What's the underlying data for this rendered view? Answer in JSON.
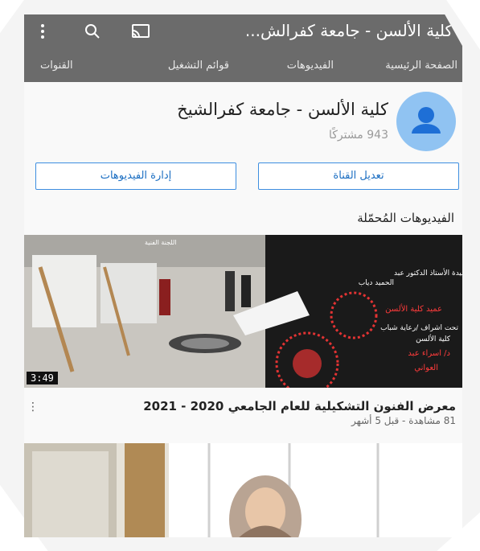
{
  "topbar": {
    "title": "كلية الألسن - جامعة كفرالش...",
    "icons": [
      "more-vert-icon",
      "search-icon",
      "cast-icon"
    ]
  },
  "tabs": [
    {
      "label": "الصفحة الرئيسية"
    },
    {
      "label": "الفيديوهات"
    },
    {
      "label": "قوائم التشغيل"
    },
    {
      "label": "القنوات"
    }
  ],
  "channel": {
    "name": "كلية الألسن - جامعة كفرالشيخ",
    "subscribers": "943 مشتركًا",
    "edit_button": "تعديل القناة",
    "manage_button": "إدارة الفيديوهات"
  },
  "section": {
    "title": "الفيديوهات المُحمّلة"
  },
  "video": {
    "title": "معرض الفنون التشكيلية للعام الجامعي 2020 - 2021",
    "meta": "81 مشاهدة - قبل 5 أشهر",
    "duration": "3:49",
    "thumbnail_text": [
      "اللجنة الفنية",
      "عميدة الأستاذ الدكتور عبد",
      "الحميد دياب",
      "عميد كلية الألسن",
      "تحت اشراف /رعاية شباب",
      "كلية الألسن",
      "د/ اسراء عبد",
      "العواني"
    ]
  },
  "colors": {
    "topbar": "#6b6b6b",
    "accent": "#3d8ee0",
    "avatar": "#90c3f2"
  }
}
